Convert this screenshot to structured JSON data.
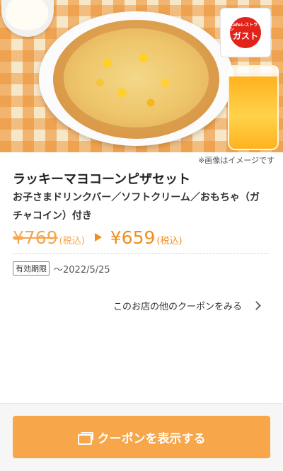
{
  "hero": {
    "logo_small_text": "Cafeレストラン",
    "logo_brand": "ガスト",
    "image_note": "※画像はイメージです"
  },
  "coupon": {
    "title": "ラッキーマヨコーンピザセット",
    "description": "お子さまドリンクバー／ソフトクリーム／おもちゃ（ガチャコイン）付き",
    "price_original": "¥769",
    "price_original_tax": "(税込)",
    "price_discounted": "¥659",
    "price_discounted_tax": "(税込)",
    "expiry_label": "有効期限",
    "expiry_date": "〜2022/5/25"
  },
  "links": {
    "other_coupons": "このお店の他のクーポンをみる"
  },
  "cta": {
    "label": "クーポンを表示する"
  },
  "colors": {
    "accent": "#f8a64a",
    "price": "#f18d1c",
    "brand_red": "#e2231a"
  }
}
